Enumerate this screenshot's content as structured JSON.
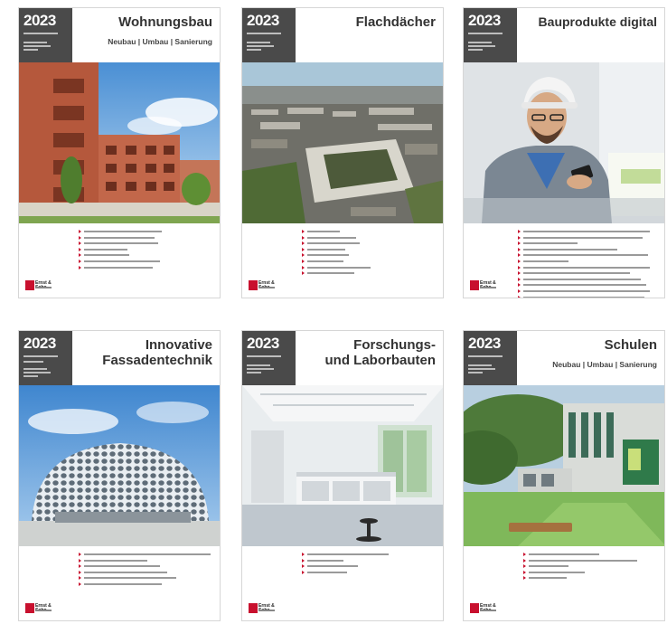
{
  "covers": [
    {
      "year": "2023",
      "title_lines": [
        "Wohnungsbau"
      ],
      "subtitle": "Neubau | Umbau | Sanierung",
      "photo_icon": "residential-building-photo",
      "logo": "Ernst & Sohn",
      "bullet_count": 6
    },
    {
      "year": "2023",
      "title_lines": [
        "Flachdächer"
      ],
      "subtitle": "",
      "photo_icon": "aerial-city-flat-roofs-photo",
      "logo": "Ernst & Sohn",
      "bullet_count": 8
    },
    {
      "year": "2023",
      "title_lines": [
        "Bauprodukte digital"
      ],
      "subtitle": "",
      "photo_icon": "engineer-with-smartphone-photo",
      "logo": "Ernst & Sohn",
      "bullet_count": 12
    },
    {
      "year": "2023",
      "title_lines": [
        "Innovative",
        "Fassadentechnik"
      ],
      "subtitle": "",
      "photo_icon": "perforated-facade-building-photo",
      "logo": "Ernst & Sohn",
      "bullet_count": 6
    },
    {
      "year": "2023",
      "title_lines": [
        "Forschungs-",
        "und Laborbauten"
      ],
      "subtitle": "",
      "photo_icon": "laboratory-interior-photo",
      "logo": "Ernst & Sohn",
      "bullet_count": 4
    },
    {
      "year": "2023",
      "title_lines": [
        "Schulen"
      ],
      "subtitle": "Neubau | Umbau | Sanierung",
      "photo_icon": "school-courtyard-photo",
      "logo": "Ernst & Sohn",
      "bullet_count": 5
    }
  ],
  "colors": {
    "year_box": "#4a4a4a",
    "brand_red": "#c8102e",
    "title_text": "#333333"
  }
}
